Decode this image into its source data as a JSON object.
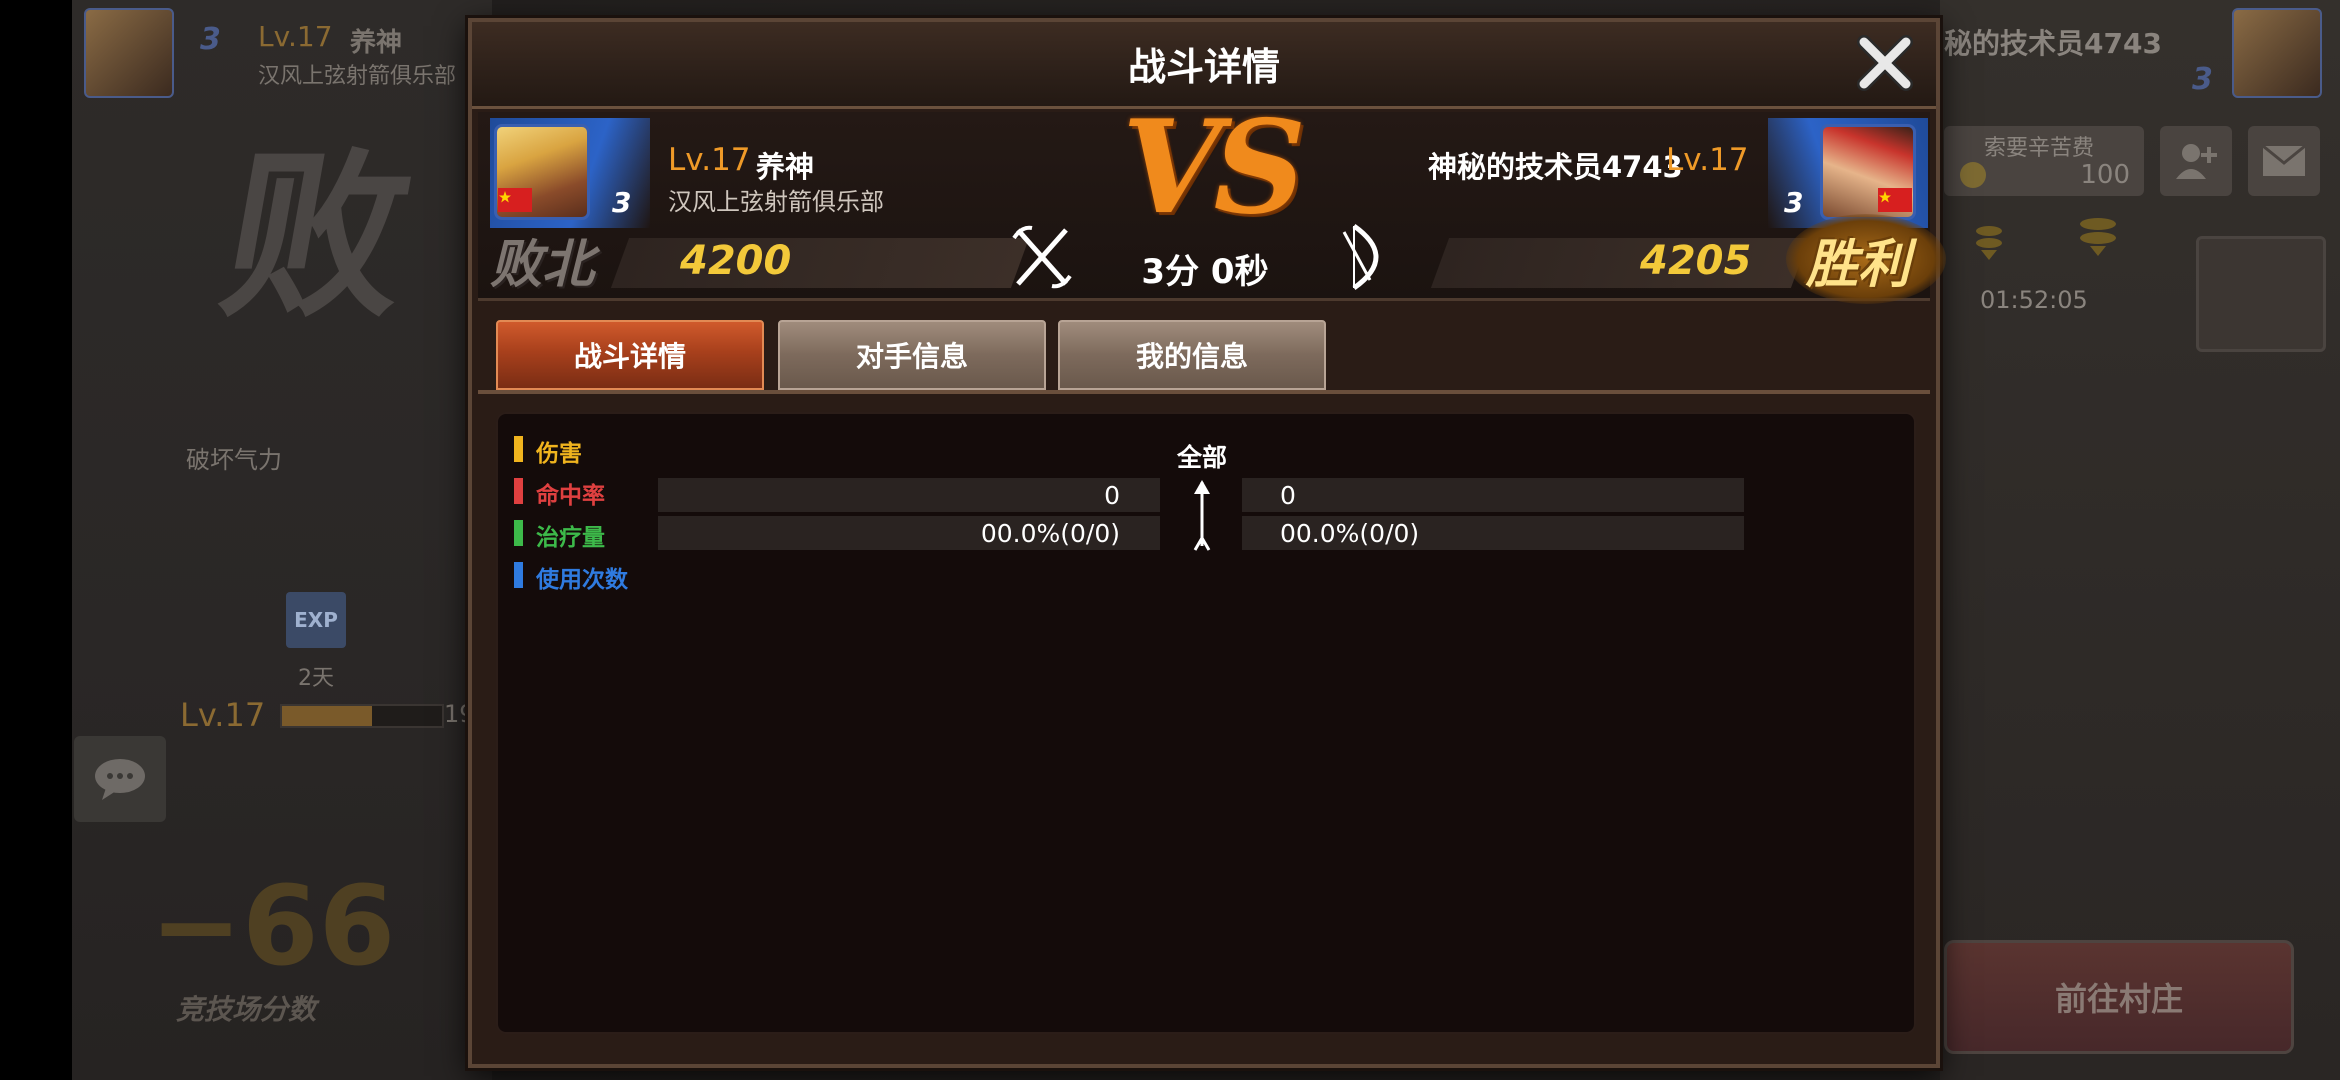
{
  "background": {
    "left_player": {
      "level": "Lv.17",
      "name": "养神",
      "club": "汉风上弦射箭俱乐部",
      "rank_badge": "3"
    },
    "right_player": {
      "name": "秘的技术员4743",
      "rank_badge": "3"
    },
    "defeat_watermark": "败",
    "break_qi_label": "破坏气力",
    "exp_icon_label": "EXP",
    "exp_days": "2天",
    "level_bar": {
      "level": "Lv.17",
      "value": "19"
    },
    "score_change": "−66",
    "arena_score_label": "竞技场分数",
    "fee_label": "索要辛苦费",
    "fee_value": "100",
    "timer": "01:52:05",
    "goto_village_button": "前往村庄"
  },
  "modal": {
    "title": "战斗详情",
    "close_icon": "close-icon",
    "left_player": {
      "level": "Lv.17",
      "name": "养神",
      "club": "汉风上弦射箭俱乐部",
      "rank_badge": "3",
      "score": "4200",
      "result": "败北"
    },
    "right_player": {
      "level": "Lv.17",
      "name": "神秘的技术员4743",
      "rank_badge": "3",
      "score": "4205",
      "result": "胜利"
    },
    "vs_label": "VS",
    "duration": "3分 0秒",
    "tabs": [
      {
        "label": "战斗详情",
        "active": true
      },
      {
        "label": "对手信息",
        "active": false
      },
      {
        "label": "我的信息",
        "active": false
      }
    ],
    "legend": [
      {
        "label": "伤害",
        "color": "#f0b41e"
      },
      {
        "label": "命中率",
        "color": "#e04040"
      },
      {
        "label": "治疗量",
        "color": "#3dba4a"
      },
      {
        "label": "使用次数",
        "color": "#2f7be0"
      }
    ],
    "column_header": "全部",
    "stats": [
      {
        "left": "0",
        "right": "0"
      },
      {
        "left": "00.0%(0/0)",
        "right": "00.0%(0/0)"
      }
    ]
  },
  "colors": {
    "accent_orange": "#ef9a28",
    "score_yellow": "#f3c93a",
    "active_tab": "#b84a22",
    "inactive_tab": "#7d6a5c"
  }
}
